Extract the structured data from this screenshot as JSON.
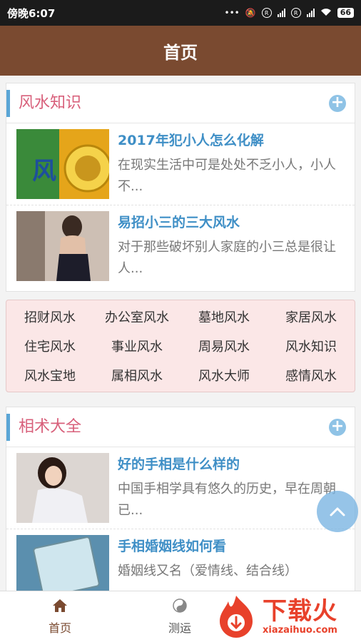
{
  "status_bar": {
    "time": "傍晚6:07",
    "battery": "66"
  },
  "app_bar": {
    "title": "首页"
  },
  "fengshui_section": {
    "title": "风水知识",
    "articles": [
      {
        "title": "2017年犯小人怎么化解",
        "desc": "在现实生活中可是处处不乏小人，小人不..."
      },
      {
        "title": "易招小三的三大风水",
        "desc": "对于那些破坏别人家庭的小三总是很让人..."
      }
    ]
  },
  "tags": [
    "招财风水",
    "办公室风水",
    "墓地风水",
    "家居风水",
    "住宅风水",
    "事业风水",
    "周易风水",
    "风水知识",
    "风水宝地",
    "属相风水",
    "风水大师",
    "感情风水"
  ],
  "xiangshu_section": {
    "title": "相术大全",
    "articles": [
      {
        "title": "好的手相是什么样的",
        "desc": "中国手相学具有悠久的历史，早在周朝已..."
      },
      {
        "title": "手相婚姻线如何看",
        "desc": "婚姻线又名（爱情线、结合线）"
      }
    ]
  },
  "bottom_nav": {
    "home": "首页",
    "fortune": "测运"
  },
  "watermark": {
    "brand": "下载火",
    "domain": "xiazaihuo.com"
  },
  "colors": {
    "app_bar": "#7a4a30",
    "section_title": "#d8607b",
    "article_title": "#3f8fc6",
    "accent_bar": "#5aa6d6",
    "tags_bg": "#fbe7e7"
  }
}
